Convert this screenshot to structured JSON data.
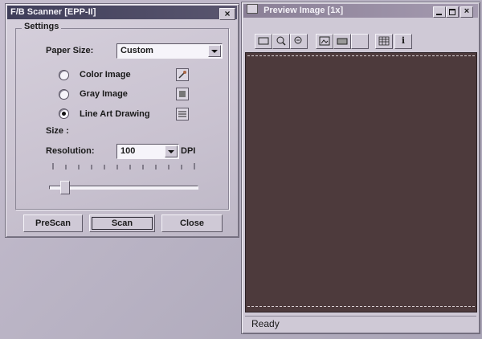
{
  "scanner_window": {
    "title": "F/B Scanner [EPP-II]",
    "close_glyph": "×",
    "settings_group_label": "Settings",
    "paper_size_label": "Paper Size:",
    "paper_size_value": "Custom",
    "modes": [
      {
        "label": "Color Image",
        "selected": false,
        "icon": "color-image-icon"
      },
      {
        "label": "Gray Image",
        "selected": false,
        "icon": "gray-image-icon"
      },
      {
        "label": "Line Art Drawing",
        "selected": true,
        "icon": "line-art-icon"
      }
    ],
    "size_label": "Size :",
    "resolution_label": "Resolution:",
    "resolution_value": "100",
    "resolution_unit": "DPI",
    "resolution_slider_level": 0.08,
    "buttons": {
      "prescan": "PreScan",
      "scan": "Scan",
      "close": "Close"
    }
  },
  "preview_window": {
    "title": "Preview Image [1x]",
    "toolbar_icons": [
      "select-area-icon",
      "zoom-in-icon",
      "zoom-out-icon",
      "image-view-icon",
      "preview-fit-icon",
      "blank-icon",
      "grid-icon",
      "info-icon"
    ],
    "info_glyph": "i",
    "status_text": "Ready",
    "colors": {
      "canvas": "#4d3a3c",
      "titlebar": "#8a7f96"
    }
  }
}
